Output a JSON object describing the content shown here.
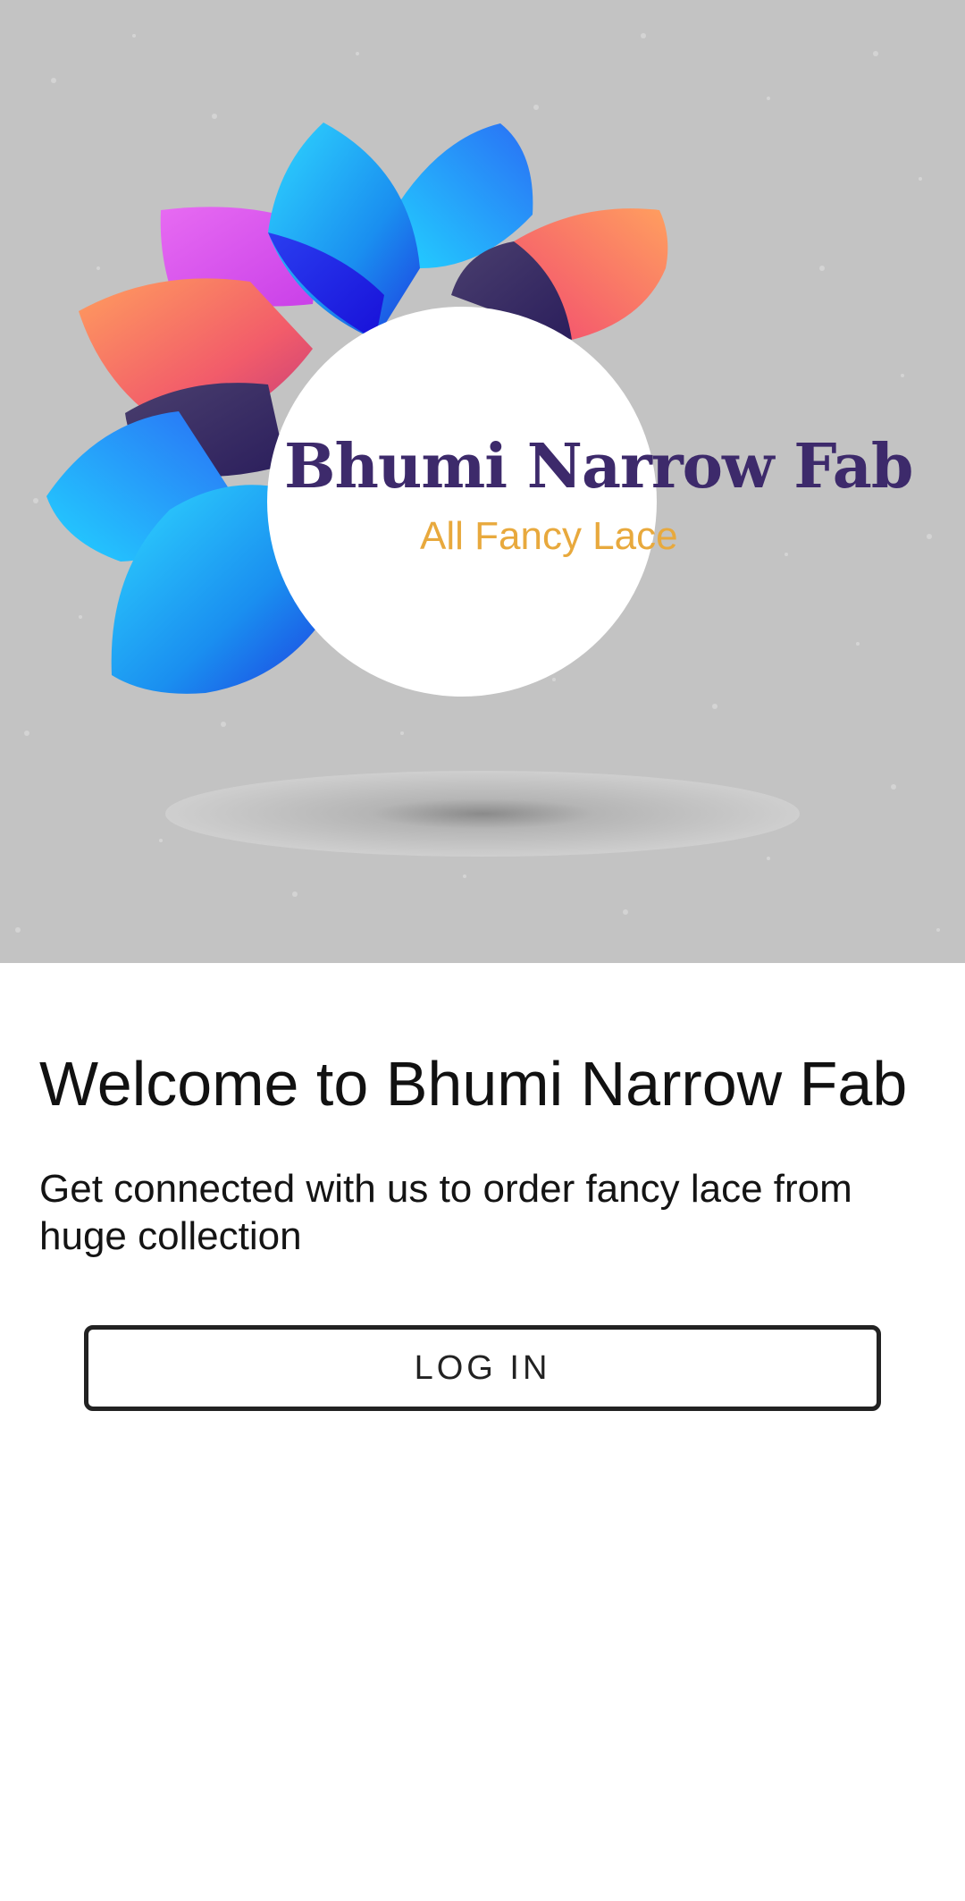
{
  "logo": {
    "brand_name": "Bhumi Narrow Fab",
    "tagline": "All Fancy Lace"
  },
  "welcome": {
    "title": "Welcome to Bhumi Narrow Fab",
    "subtitle": "Get connected with us to order fancy lace from huge collection"
  },
  "actions": {
    "login_label": "LOG IN"
  },
  "colors": {
    "hero_background": "#c3c3c3",
    "brand_text": "#3d2a6b",
    "tagline_text": "#e8a93d",
    "button_border": "#222222"
  }
}
